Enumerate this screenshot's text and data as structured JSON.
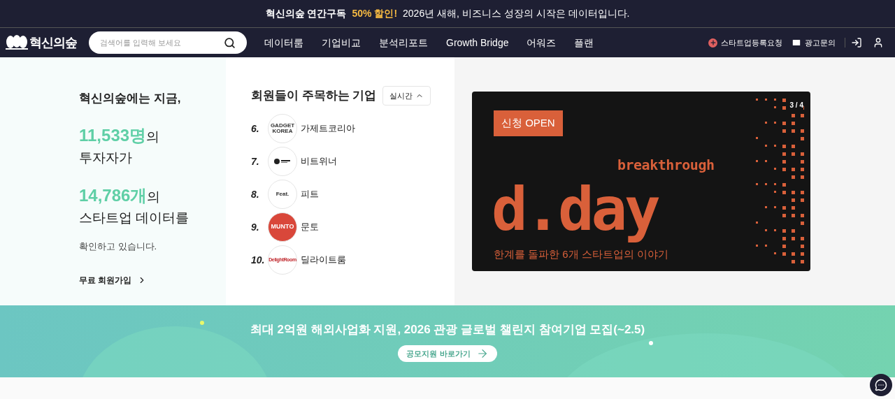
{
  "promo_bar": {
    "brand": "혁신의숲 연간구독",
    "highlight": "50% 할인!",
    "message": "2026년 새해, 비즈니스 성장의 시작은 데이터입니다."
  },
  "nav": {
    "logo": "혁신의숲",
    "search": {
      "placeholder": "검색어를 입력해 보세요"
    },
    "menu": [
      "데이터룸",
      "기업비교",
      "분석리포트",
      "Growth Bridge",
      "어워즈",
      "플랜"
    ],
    "actions": [
      {
        "kind": "plus",
        "label": "스타트업등록요청"
      },
      {
        "kind": "mail",
        "label": "광고문의"
      }
    ]
  },
  "stats": {
    "title": "혁신의숲에는 지금,",
    "investors_count": "11,533명",
    "investors_suffix": "의",
    "investors_label": "투자자가",
    "startups_count": "14,786개",
    "startups_suffix": "의",
    "startups_label": "스타트업 데이터를",
    "footer": "확인하고 있습니다.",
    "signup": "무료 회원가입"
  },
  "trending": {
    "title": "회원들이 주목하는 기업",
    "filter": "실시간",
    "companies": [
      {
        "rank": "6.",
        "logo_text": "GADGET KOREA",
        "kind": "text",
        "name": "가제트코리아"
      },
      {
        "rank": "7.",
        "kind": "mark",
        "name": "비트위너"
      },
      {
        "rank": "8.",
        "logo_text": "Feat.",
        "kind": "text",
        "name": "피트"
      },
      {
        "rank": "9.",
        "logo_text": "MUNTO",
        "kind": "filled",
        "name": "문토"
      },
      {
        "rank": "10.",
        "logo_text": "DelightRoom",
        "kind": "red",
        "name": "딜라이트룸"
      }
    ]
  },
  "carousel": {
    "badge": "신청 OPEN",
    "subtitle": "breakthrough",
    "headline": "d.day",
    "caption": "한계를 돌파한 6개 스타트업의 이야기",
    "counter": "3 / 4"
  },
  "banner": {
    "title": "최대 2억원 해외사업화 지원, 2026 관광 글로벌 챌린지 참여기업 모집(~2.5)",
    "button": "공모지원 바로가기"
  }
}
